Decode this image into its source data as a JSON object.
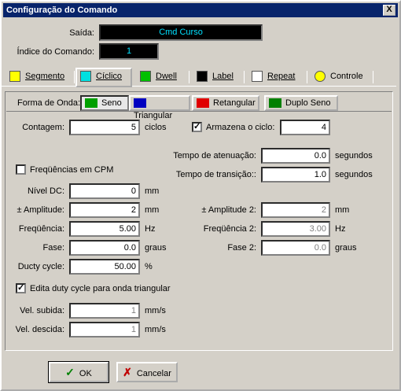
{
  "window": {
    "title": "Configuração do Comando",
    "close_label": "X"
  },
  "header": {
    "saida_label": "Saída:",
    "saida_value": "Cmd Curso",
    "indice_label": "Índice do Comando:",
    "indice_value": "1"
  },
  "tabs": [
    {
      "label": "Segmento",
      "icon": "segment-icon",
      "active": false
    },
    {
      "label": "Cíclico",
      "icon": "cyclic-icon",
      "active": true
    },
    {
      "label": "Dwell",
      "icon": "dwell-icon",
      "active": false
    },
    {
      "label": "Label",
      "icon": "label-icon",
      "active": false
    },
    {
      "label": "Repeat",
      "icon": "repeat-icon",
      "active": false
    },
    {
      "label": "Controle",
      "icon": "control-icon",
      "active": false
    }
  ],
  "waveform": {
    "label": "Forma de Onda:",
    "options": [
      {
        "label": "Seno",
        "icon": "sine-icon",
        "active": true
      },
      {
        "label": "Triangular",
        "icon": "triangle-wave-icon",
        "active": false
      },
      {
        "label": "Retangular",
        "icon": "square-wave-icon",
        "active": false
      },
      {
        "label": "Duplo Seno",
        "icon": "double-sine-icon",
        "active": false
      }
    ]
  },
  "form": {
    "contagem_label": "Contagem:",
    "contagem_value": "5",
    "contagem_unit": "ciclos",
    "armazena_label": "Armazena o ciclo:",
    "armazena_checked": true,
    "armazena_value": "4",
    "atenuacao_label": "Tempo de atenuação:",
    "atenuacao_value": "0.0",
    "atenuacao_unit": "segundos",
    "transicao_label": "Tempo de transição::",
    "transicao_value": "1.0",
    "transicao_unit": "segundos",
    "freq_cpm_label": "Freqüências em CPM",
    "freq_cpm_checked": false,
    "nivel_label": "Nível DC:",
    "nivel_value": "0",
    "nivel_unit": "mm",
    "amp_label": "± Amplitude:",
    "amp_value": "2",
    "amp_unit": "mm",
    "amp2_label": "± Amplitude 2:",
    "amp2_value": "2",
    "amp2_unit": "mm",
    "freq_label": "Freqüência:",
    "freq_value": "5.00",
    "freq_unit": "Hz",
    "freq2_label": "Freqüência 2:",
    "freq2_value": "3.00",
    "freq2_unit": "Hz",
    "fase_label": "Fase:",
    "fase_value": "0.0",
    "fase_unit": "graus",
    "fase2_label": "Fase 2:",
    "fase2_value": "0.0",
    "fase2_unit": "graus",
    "duty_label": "Ducty cycle:",
    "duty_value": "50.00",
    "duty_unit": "%",
    "edita_label": "Edita duty cycle para onda triangular",
    "edita_checked": true,
    "subida_label": "Vel. subida:",
    "subida_value": "1",
    "subida_unit": "mm/s",
    "descida_label": "Vel. descida:",
    "descida_value": "1",
    "descida_unit": "mm/s"
  },
  "buttons": {
    "ok_label": "OK",
    "cancel_label": "Cancelar"
  },
  "check_mark": "✓"
}
